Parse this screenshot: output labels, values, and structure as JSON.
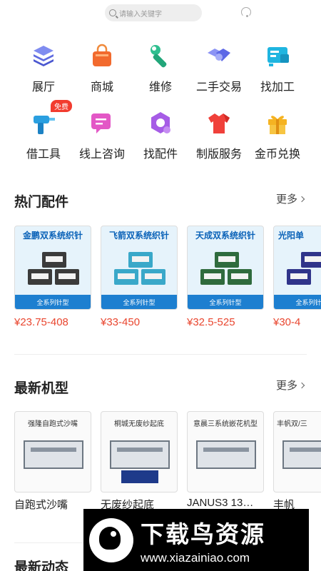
{
  "search": {
    "placeholder": "请输入关键字"
  },
  "categories": [
    {
      "label": "展厅",
      "icon": "layers-icon"
    },
    {
      "label": "商城",
      "icon": "shopping-bag-icon"
    },
    {
      "label": "维修",
      "icon": "wrench-icon"
    },
    {
      "label": "二手交易",
      "icon": "handshake-icon"
    },
    {
      "label": "找加工",
      "icon": "machine-icon"
    },
    {
      "label": "借工具",
      "icon": "drill-icon",
      "badge": "免费"
    },
    {
      "label": "线上咨询",
      "icon": "chat-icon"
    },
    {
      "label": "找配件",
      "icon": "nut-icon"
    },
    {
      "label": "制版服务",
      "icon": "shirt-icon"
    },
    {
      "label": "金币兑换",
      "icon": "gift-icon"
    }
  ],
  "hot_parts": {
    "title": "热门配件",
    "more": "更多",
    "items": [
      {
        "title": "金鹏双系统织针",
        "band": "全系列针型",
        "price": "¥23.75-408",
        "box_color": "#3b3b3b"
      },
      {
        "title": "飞箭双系统织针",
        "band": "全系列针型",
        "price": "¥33-450",
        "box_color": "#3aa8c9"
      },
      {
        "title": "天成双系统织针",
        "band": "全系列针型",
        "price": "¥32.5-525",
        "box_color": "#2f6b3d"
      },
      {
        "title": "光阳单",
        "band": "全系列针型",
        "price": "¥30-4",
        "box_color": "#30348a"
      }
    ]
  },
  "new_machines": {
    "title": "最新机型",
    "more": "更多",
    "items": [
      {
        "img_title": "强隆自跑式沙嘴",
        "name": "自跑式沙嘴"
      },
      {
        "img_title": "桐城无废纱起底",
        "name": "无废纱起底"
      },
      {
        "img_title": "意晨三系统嵌花机型",
        "name": "JANUS3 13…"
      },
      {
        "img_title": "丰帆双/三",
        "name": "丰帆"
      }
    ]
  },
  "latest_news": {
    "title": "最新动态"
  },
  "watermark": {
    "title": "下载鸟资源",
    "url": "www.xiazainiao.com"
  }
}
